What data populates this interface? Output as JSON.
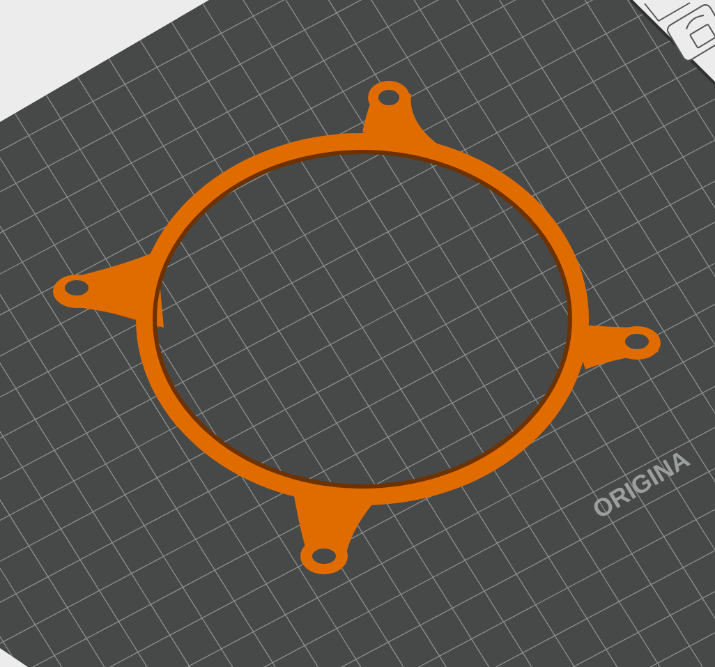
{
  "viewport": {
    "bed_label": "ORIGINA"
  }
}
